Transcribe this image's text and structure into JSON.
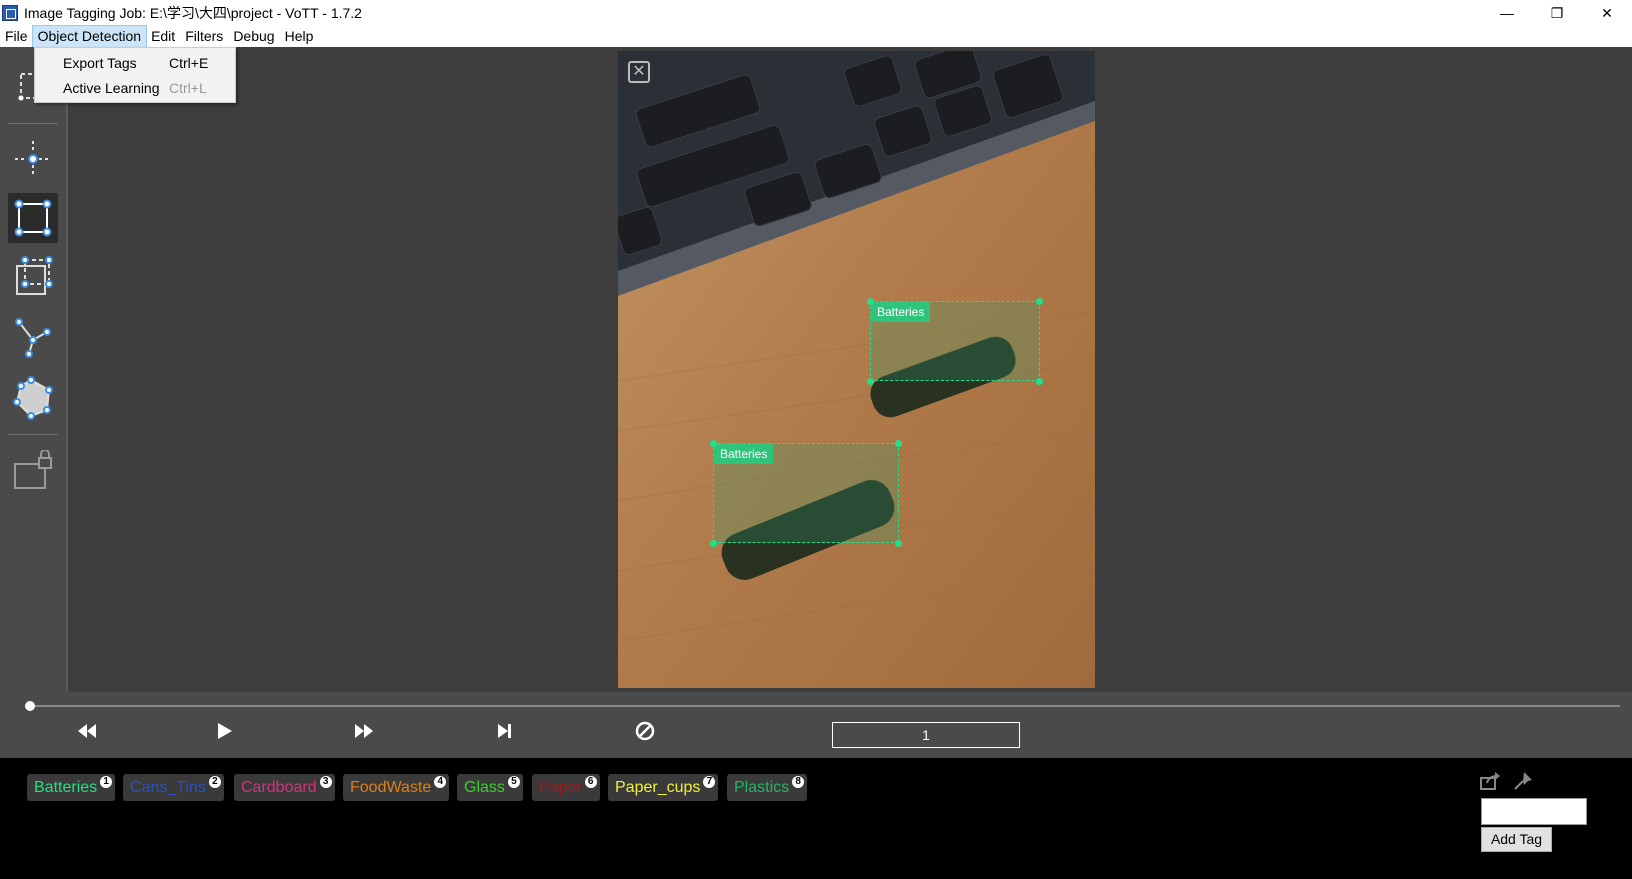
{
  "window": {
    "title": "Image Tagging Job: E:\\学习\\大四\\project - VoTT - 1.7.2",
    "minimize": "—",
    "restore": "❐",
    "close": "✕"
  },
  "menubar": {
    "items": [
      "File",
      "Object Detection",
      "Edit",
      "Filters",
      "Debug",
      "Help"
    ],
    "active_item": "Object Detection"
  },
  "dropdown": {
    "items": [
      {
        "label": "Export Tags",
        "shortcut": "Ctrl+E",
        "enabled": true
      },
      {
        "label": "Active Learning",
        "shortcut": "Ctrl+L",
        "enabled": false
      }
    ]
  },
  "toolbar": {
    "tools": [
      "rectangle-select-tool",
      "point-tool",
      "rectangle-tool",
      "copy-rectangle-tool",
      "polyline-tool",
      "polygon-tool",
      "lock-tool"
    ],
    "selected": "rectangle-tool"
  },
  "canvas": {
    "regions": [
      {
        "tag": "Batteries"
      },
      {
        "tag": "Batteries"
      }
    ],
    "close_icon": "✕"
  },
  "playback": {
    "frame_value": "1",
    "progress": 0
  },
  "tags": [
    {
      "name": "Batteries",
      "number": "1",
      "color": "#25e07c"
    },
    {
      "name": "Cans_Tins",
      "number": "2",
      "color": "#2a52be"
    },
    {
      "name": "Cardboard",
      "number": "3",
      "color": "#d0347e"
    },
    {
      "name": "FoodWaste",
      "number": "4",
      "color": "#e07f10"
    },
    {
      "name": "Glass",
      "number": "5",
      "color": "#3ecf2a"
    },
    {
      "name": "Paper",
      "number": "6",
      "color": "#9e1b1b"
    },
    {
      "name": "Paper_cups",
      "number": "7",
      "color": "#f0f03a"
    },
    {
      "name": "Plastics",
      "number": "8",
      "color": "#1fb866"
    }
  ],
  "tag_panel": {
    "add_tag_label": "Add Tag",
    "add_tag_value": ""
  }
}
